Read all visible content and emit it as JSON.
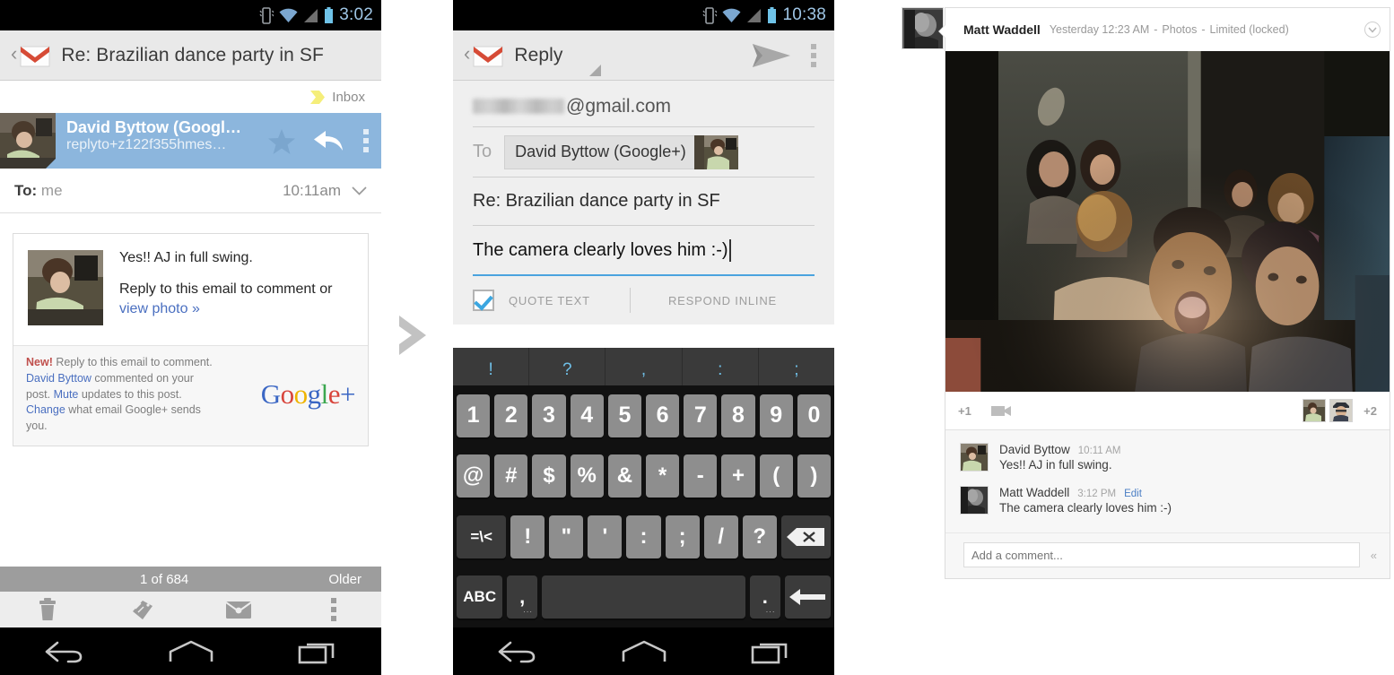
{
  "panel1": {
    "statusbar": {
      "time": "3:02",
      "icons": [
        "vibrate-icon",
        "wifi-icon",
        "signal-icon",
        "battery-icon"
      ]
    },
    "actionbar": {
      "back": "‹",
      "logo": "gmail-logo",
      "title": "Re: Brazilian dance party in SF"
    },
    "label": {
      "text": "Inbox",
      "chip_color": "#f5ee7a"
    },
    "sender": {
      "name": "David Byttow (Googl…",
      "address": "replyto+z122f355hmes…",
      "star": "★",
      "row_color": "#8cb6dd"
    },
    "recipient": {
      "label": "To:",
      "value": "me",
      "time": "10:11am",
      "expand": "⌄"
    },
    "card": {
      "line1": "Yes!! AJ in full swing.",
      "line2_pre": "Reply to this email to comment or ",
      "line2_link": "view photo »",
      "note_new": "New!",
      "note_1": " Reply to this email to comment. ",
      "note_link1": "David Byttow",
      "note_2": " commented on your post. ",
      "note_link2": "Mute",
      "note_3": " updates to this post. ",
      "note_link3": "Change",
      "note_4": " what email Google+ sends you.",
      "brand": {
        "g1": "G",
        "o1": "o",
        "o2": "o",
        "g2": "g",
        "l": "l",
        "e": "e",
        "plus": "+"
      }
    },
    "navstrip": {
      "counter": "1 of 684",
      "older": "Older"
    },
    "toolbar": [
      {
        "name": "delete-icon",
        "label": "Delete"
      },
      {
        "name": "labels-icon",
        "label": "Labels"
      },
      {
        "name": "mark-unread-icon",
        "label": "Mark unread"
      },
      {
        "name": "overflow-icon",
        "label": "More options"
      }
    ],
    "sysbar": [
      {
        "name": "back-nav-icon",
        "label": "Back"
      },
      {
        "name": "home-nav-icon",
        "label": "Home"
      },
      {
        "name": "recents-nav-icon",
        "label": "Recents"
      }
    ]
  },
  "panel2": {
    "statusbar": {
      "time": "10:38"
    },
    "actionbar": {
      "back": "‹",
      "title": "Reply",
      "send": "send-icon",
      "overflow": "overflow-icon"
    },
    "from": {
      "blurred": true,
      "domain": "@gmail.com"
    },
    "to": {
      "label": "To",
      "chip": "David Byttow (Google+)"
    },
    "subject": "Re: Brazilian dance party in SF",
    "body": "The camera clearly loves him :-)",
    "options": {
      "quote_checked": true,
      "quote_label": "QUOTE TEXT",
      "respond_label": "RESPOND INLINE"
    },
    "keyboard": {
      "suggestions": [
        "!",
        "?",
        ",",
        ":",
        ";"
      ],
      "row_numbers": [
        "1",
        "2",
        "3",
        "4",
        "5",
        "6",
        "7",
        "8",
        "9",
        "0"
      ],
      "row_symbols": [
        "@",
        "#",
        "$",
        "%",
        "&",
        "*",
        "-",
        "+",
        "(",
        ")"
      ],
      "row_punct": [
        "=\\<",
        "!",
        "\"",
        "'",
        ":",
        ";",
        "/",
        "?"
      ],
      "backspace": "backspace-icon",
      "bottom": {
        "abc": "ABC",
        "comma": ",",
        "space": "",
        "period": ".",
        "enter": "enter-icon"
      }
    },
    "sysbar": [
      {
        "name": "back-nav-icon",
        "label": "Back"
      },
      {
        "name": "home-nav-icon",
        "label": "Home"
      },
      {
        "name": "recents-nav-icon",
        "label": "Recents"
      }
    ]
  },
  "panel3": {
    "author": "Matt Waddell",
    "meta_time": "Yesterday 12:23 AM",
    "meta_type": "Photos",
    "meta_vis": "Limited (locked)",
    "sep": "-",
    "plus_one": "+1",
    "more_count": "+2",
    "comments": [
      {
        "name": "David Byttow",
        "time": "10:11 AM",
        "edit": "",
        "text": "Yes!! AJ in full swing."
      },
      {
        "name": "Matt Waddell",
        "time": "3:12 PM",
        "edit": "Edit",
        "text": "The camera clearly loves him :-)"
      }
    ],
    "add_comment_placeholder": "Add a comment...",
    "collapse_icon": "«"
  },
  "arrows": {
    "glyph": "chevron-right",
    "color": "#c2c2c2"
  }
}
